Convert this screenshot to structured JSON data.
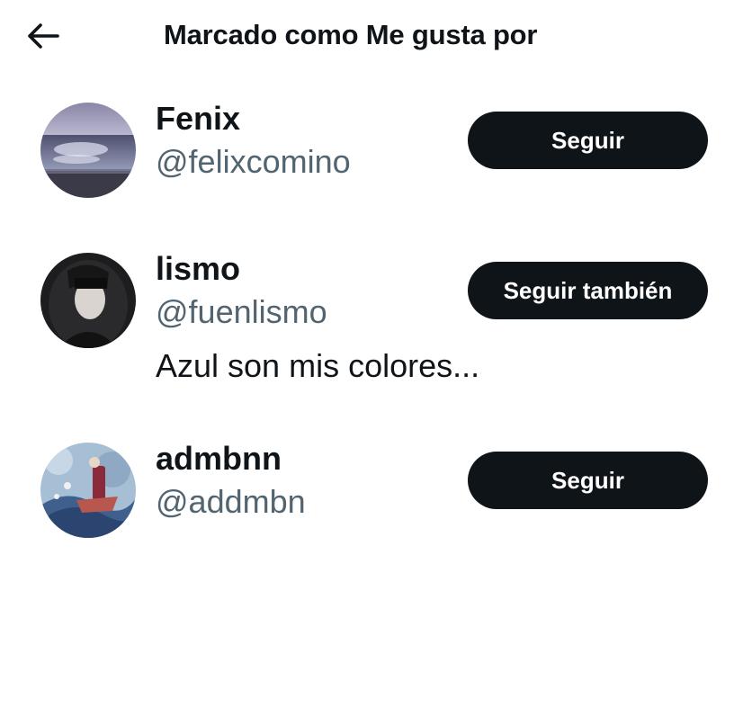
{
  "header": {
    "back_icon": "arrow-left-icon",
    "title": "Marcado como Me gusta por"
  },
  "users": [
    {
      "name": "Fenix",
      "handle": "@felixcomino",
      "bio": "",
      "button_label": "Seguir"
    },
    {
      "name": "lismo",
      "handle": "@fuenlismo",
      "bio": "Azul son mis colores...",
      "button_label": "Seguir también"
    },
    {
      "name": "admbnn",
      "handle": "@addmbn",
      "bio": "",
      "button_label": "Seguir"
    }
  ],
  "colors": {
    "text_primary": "#0f1419",
    "text_secondary": "#536471",
    "button_bg": "#0f1419",
    "button_text": "#ffffff"
  }
}
